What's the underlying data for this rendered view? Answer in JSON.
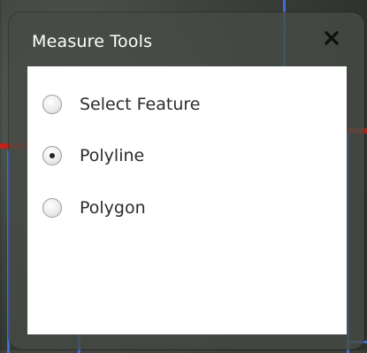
{
  "window": {
    "title": "Measure Tools",
    "close_icon": "close-icon"
  },
  "options": [
    {
      "label": "Select Feature",
      "checked": false
    },
    {
      "label": "Polyline",
      "checked": true
    },
    {
      "label": "Polygon",
      "checked": false
    }
  ],
  "colors": {
    "window_bg": "#464a44",
    "title_text": "#ffffff",
    "panel_bg": "#ffffff",
    "label_text": "#2b2b2b",
    "map_road_red": "#c0221b",
    "map_road_blue": "#3f6fd0"
  }
}
